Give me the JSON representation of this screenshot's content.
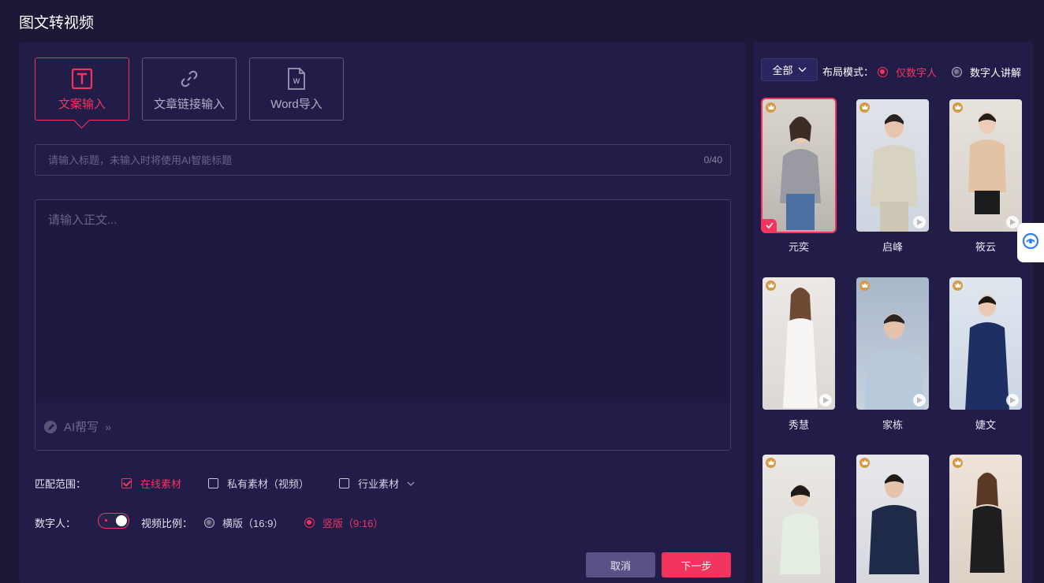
{
  "page": {
    "title": "图文转视频"
  },
  "modes": [
    {
      "label": "文案输入",
      "icon": "text-icon",
      "active": true
    },
    {
      "label": "文章链接输入",
      "icon": "link-icon",
      "active": false
    },
    {
      "label": "Word导入",
      "icon": "word-doc-icon",
      "active": false
    }
  ],
  "title_input": {
    "placeholder": "请输入标题，未输入时将使用AI智能标题",
    "value": "",
    "counter": "0/40"
  },
  "body_input": {
    "placeholder": "请输入正文...",
    "value": ""
  },
  "ai_help": {
    "label": "AI帮写",
    "chevron": "»"
  },
  "match_scope": {
    "label": "匹配范围：",
    "options": [
      {
        "label": "在线素材",
        "checked": true
      },
      {
        "label": "私有素材（视频）",
        "checked": false
      },
      {
        "label": "行业素材",
        "checked": false
      }
    ]
  },
  "digital_human": {
    "label": "数字人：",
    "enabled": true
  },
  "video_ratio": {
    "label": "视频比例：",
    "options": [
      {
        "label": "横版（16:9）",
        "selected": false
      },
      {
        "label": "竖版（9:16）",
        "selected": true
      }
    ]
  },
  "actions": {
    "cancel": "取消",
    "next": "下一步"
  },
  "right": {
    "filter": "全部",
    "layout_label": "布局模式：",
    "layout_options": [
      {
        "label": "仅数字人",
        "selected": true
      },
      {
        "label": "数字人讲解",
        "selected": false
      }
    ],
    "avatars": [
      {
        "name": "元奕",
        "selected": true
      },
      {
        "name": "启峰",
        "selected": false
      },
      {
        "name": "筱云",
        "selected": false
      },
      {
        "name": "秀慧",
        "selected": false
      },
      {
        "name": "家栋",
        "selected": false
      },
      {
        "name": "婕文",
        "selected": false
      },
      {
        "name": "",
        "selected": false
      },
      {
        "name": "",
        "selected": false
      },
      {
        "name": "",
        "selected": false
      }
    ]
  },
  "colors": {
    "accent": "#f2355f",
    "panel": "#221c48",
    "background": "#1c1836"
  }
}
